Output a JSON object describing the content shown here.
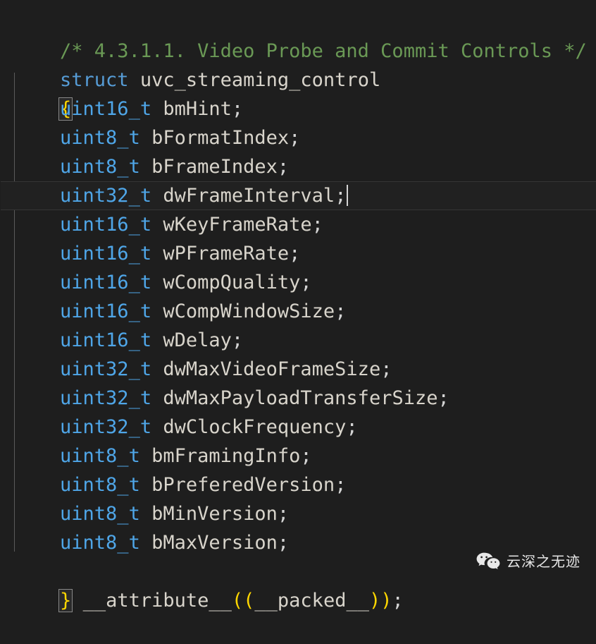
{
  "editor": {
    "background_color": "#1e1e1e",
    "default_text_color": "#d4d4d4",
    "comment_color": "#6a9955",
    "keyword_color": "#569cd6",
    "type_color": "#4fa6e8",
    "bracket_color": "#ffd700",
    "active_line_color": "#212121",
    "language": "c"
  },
  "code": {
    "line1": {
      "comment": "/* 4.3.1.1. Video Probe and Commit Controls */"
    },
    "line2": {
      "keyword": "struct",
      "space": " ",
      "identifier": "uvc_streaming_control"
    },
    "line3": {
      "open_brace": "{"
    },
    "members": [
      {
        "type": "uint16_t",
        "name": "bmHint",
        "semicolon": ";",
        "active": false
      },
      {
        "type": "uint8_t",
        "name": "bFormatIndex",
        "semicolon": ";",
        "active": false
      },
      {
        "type": "uint8_t",
        "name": "bFrameIndex",
        "semicolon": ";",
        "active": false
      },
      {
        "type": "uint32_t",
        "name": "dwFrameInterval",
        "semicolon": ";",
        "active": true
      },
      {
        "type": "uint16_t",
        "name": "wKeyFrameRate",
        "semicolon": ";",
        "active": false
      },
      {
        "type": "uint16_t",
        "name": "wPFrameRate",
        "semicolon": ";",
        "active": false
      },
      {
        "type": "uint16_t",
        "name": "wCompQuality",
        "semicolon": ";",
        "active": false
      },
      {
        "type": "uint16_t",
        "name": "wCompWindowSize",
        "semicolon": ";",
        "active": false
      },
      {
        "type": "uint16_t",
        "name": "wDelay",
        "semicolon": ";",
        "active": false
      },
      {
        "type": "uint32_t",
        "name": "dwMaxVideoFrameSize",
        "semicolon": ";",
        "active": false
      },
      {
        "type": "uint32_t",
        "name": "dwMaxPayloadTransferSize",
        "semicolon": ";",
        "active": false
      },
      {
        "type": "uint32_t",
        "name": "dwClockFrequency",
        "semicolon": ";",
        "active": false
      },
      {
        "type": "uint8_t",
        "name": "bmFramingInfo",
        "semicolon": ";",
        "active": false
      },
      {
        "type": "uint8_t",
        "name": "bPreferedVersion",
        "semicolon": ";",
        "active": false
      },
      {
        "type": "uint8_t",
        "name": "bMinVersion",
        "semicolon": ";",
        "active": false
      },
      {
        "type": "uint8_t",
        "name": "bMaxVersion",
        "semicolon": ";",
        "active": false
      }
    ],
    "last_line": {
      "close_brace": "}",
      "gap": " ",
      "attribute_keyword": "__attribute__",
      "open_parens": "((",
      "packed": "__packed__",
      "close_parens": "))",
      "semicolon": ";"
    },
    "indent": "    "
  },
  "watermark": {
    "logo_icon": "wechat-icon",
    "text": "云深之无迹",
    "text_color": "#e6e6e6",
    "logo_color": "#e8e8e8"
  }
}
